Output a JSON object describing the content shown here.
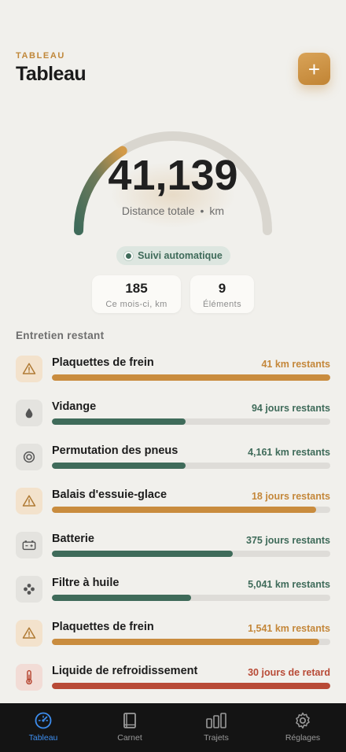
{
  "header": {
    "eyebrow": "TABLEAU",
    "title": "Tableau",
    "add_label": "+"
  },
  "odometer": {
    "distance": "41,139",
    "caption": "Distance totale",
    "separator": "•",
    "unit": "km",
    "gauge_fraction": 0.32
  },
  "tracking": {
    "label": "Suivi automatique"
  },
  "stats": [
    {
      "value": "185",
      "label": "Ce mois-ci, km"
    },
    {
      "value": "9",
      "label": "Éléments"
    }
  ],
  "section": {
    "title": "Entretien restant"
  },
  "items": [
    {
      "name": "Plaquettes de frein",
      "remaining": "41 km restants",
      "status": "orange",
      "icon": "warning-icon",
      "progress": 1.0
    },
    {
      "name": "Vidange",
      "remaining": "94 jours restants",
      "status": "green",
      "icon": "oil-drop-icon",
      "progress": 0.48
    },
    {
      "name": "Permutation des pneus",
      "remaining": "4,161 km restants",
      "status": "green",
      "icon": "tire-icon",
      "progress": 0.48
    },
    {
      "name": "Balais d'essuie-glace",
      "remaining": "18 jours restants",
      "status": "orange",
      "icon": "warning-icon",
      "progress": 0.95
    },
    {
      "name": "Batterie",
      "remaining": "375 jours restants",
      "status": "green",
      "icon": "battery-icon",
      "progress": 0.65
    },
    {
      "name": "Filtre à huile",
      "remaining": "5,041 km restants",
      "status": "green",
      "icon": "filter-icon",
      "progress": 0.5
    },
    {
      "name": "Plaquettes de frein",
      "remaining": "1,541 km restants",
      "status": "orange",
      "icon": "warning-icon",
      "progress": 0.96
    },
    {
      "name": "Liquide de refroidissement",
      "remaining": "30 jours de retard",
      "status": "red",
      "icon": "thermometer-icon",
      "progress": 1.0
    }
  ],
  "colors": {
    "accent": "#c98c3e",
    "green": "#3f6b5a",
    "danger": "#b84a36",
    "tab_active": "#3d8ef0"
  },
  "tabs": [
    {
      "label": "Tableau",
      "icon": "gauge-icon",
      "active": true
    },
    {
      "label": "Carnet",
      "icon": "book-icon",
      "active": false
    },
    {
      "label": "Trajets",
      "icon": "bar-chart-icon",
      "active": false
    },
    {
      "label": "Réglages",
      "icon": "gear-icon",
      "active": false
    }
  ]
}
